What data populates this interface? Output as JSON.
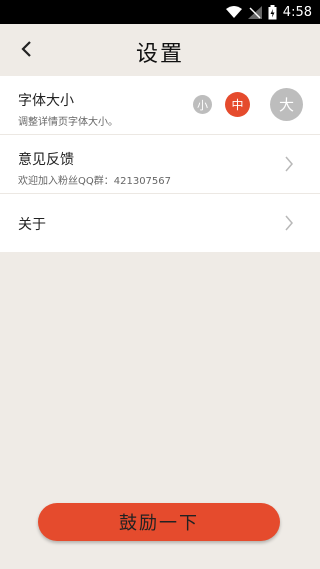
{
  "status_bar": {
    "time": "4:58"
  },
  "header": {
    "title": "设置"
  },
  "settings": {
    "font_size": {
      "label": "字体大小",
      "description": "调整详情页字体大小。",
      "options": [
        "小",
        "中",
        "大"
      ],
      "selected": "中"
    },
    "feedback": {
      "label": "意见反馈",
      "description": "欢迎加入粉丝QQ群：421307567"
    },
    "about": {
      "label": "关于"
    }
  },
  "encourage_button": {
    "label": "鼓励一下"
  },
  "colors": {
    "accent": "#e54b2d",
    "inactive_circle": "#bdbdbd",
    "background": "#efebe6"
  },
  "icons": [
    "wifi-icon",
    "signal-icon",
    "battery-icon",
    "back-arrow-icon",
    "chevron-right-icon"
  ]
}
